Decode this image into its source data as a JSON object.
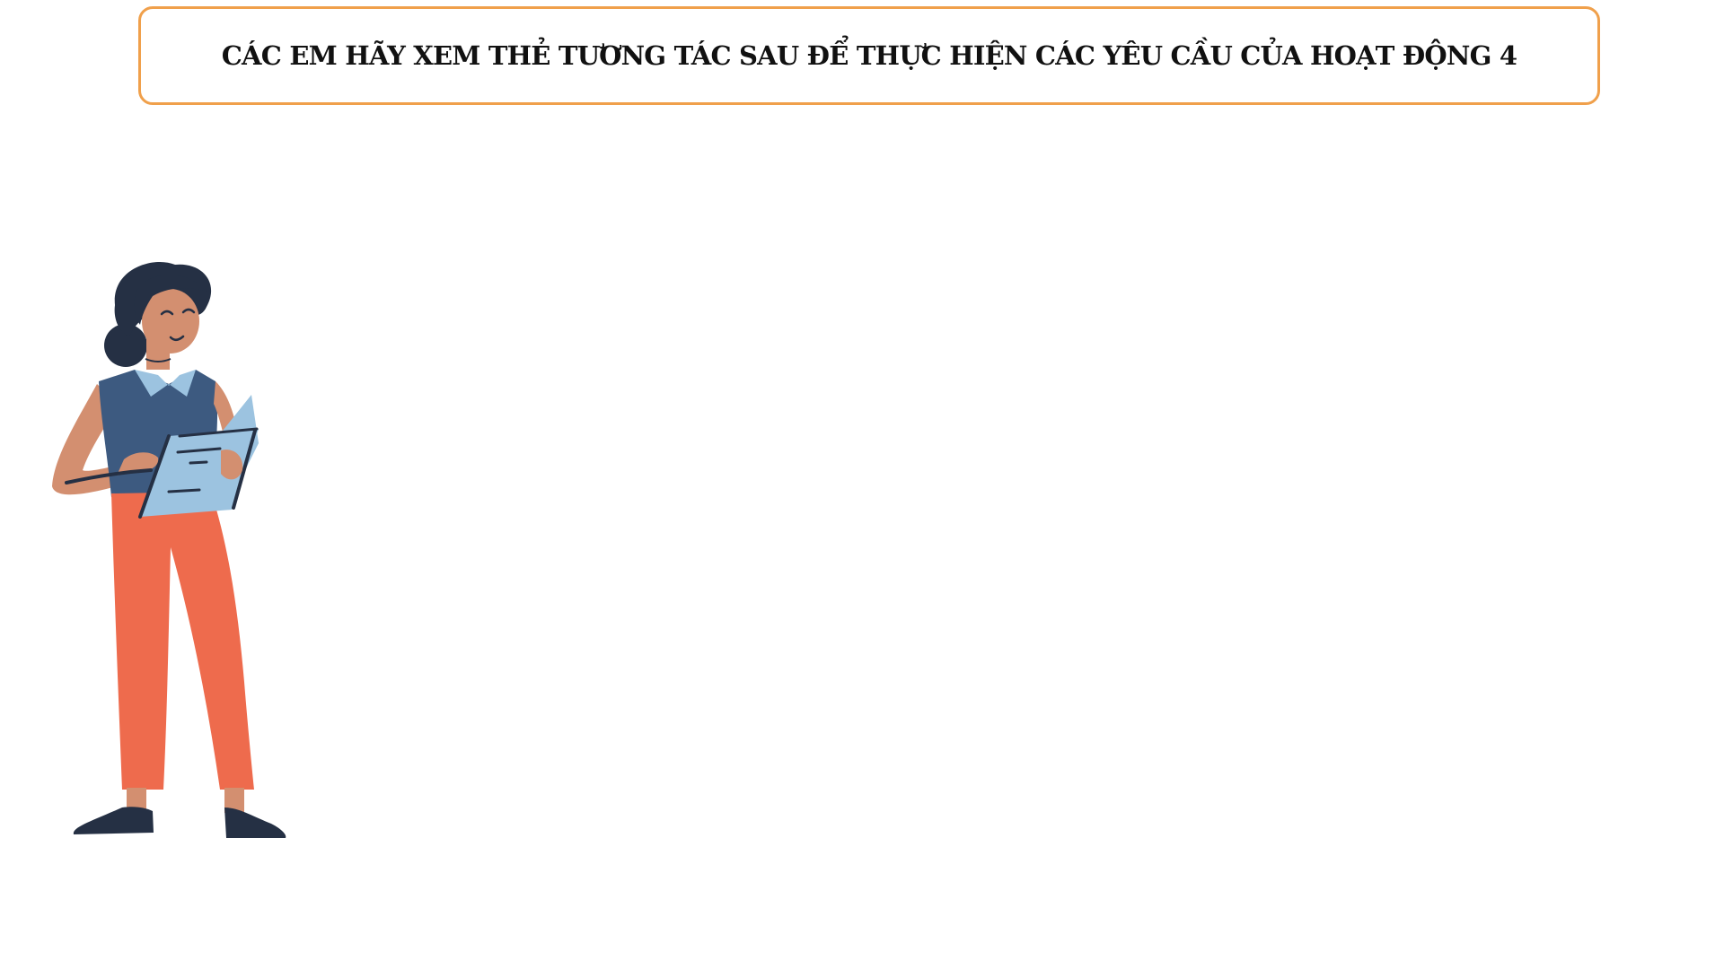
{
  "header": {
    "title": "CÁC EM HÃY XEM THẺ TƯƠNG TÁC SAU ĐỂ THỰC HIỆN CÁC YÊU CẦU CỦA HOẠT ĐỘNG 4",
    "border_color": "#f0a04b"
  },
  "illustration": {
    "subject": "woman-holding-tablet",
    "colors": {
      "hair": "#253044",
      "skin": "#d38f70",
      "top": "#3d5a80",
      "collar": "#9cc3e0",
      "pants": "#ee6b4d",
      "tablet": "#9cc3e0",
      "shoes": "#253044"
    }
  }
}
